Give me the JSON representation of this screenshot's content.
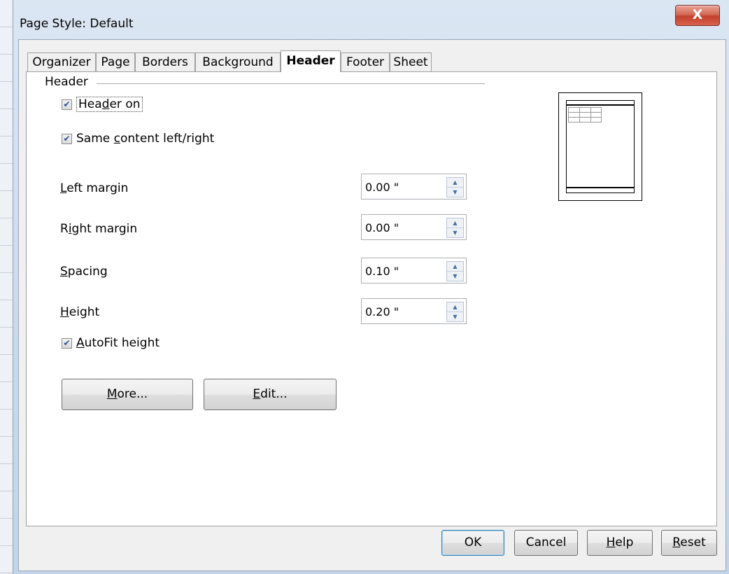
{
  "window": {
    "title": "Page Style: Default",
    "close_symbol": "X"
  },
  "tabs": [
    {
      "label": "Organizer"
    },
    {
      "label": "Page"
    },
    {
      "label": "Borders"
    },
    {
      "label": "Background"
    },
    {
      "label": "Header",
      "active": true
    },
    {
      "label": "Footer"
    },
    {
      "label": "Sheet"
    }
  ],
  "header_section": {
    "title": "Header",
    "header_on": {
      "label_pre": "Hea",
      "label_mnemonic": "d",
      "label_post": "er on",
      "checked": true
    },
    "same_content": {
      "label_pre": "Same ",
      "label_mnemonic": "c",
      "label_post": "ontent left/right",
      "checked": true
    },
    "fields": [
      {
        "label_mnemonic": "L",
        "label_rest": "eft margin",
        "value": "0.00 \""
      },
      {
        "label_pre": "R",
        "label_mnemonic": "i",
        "label_rest": "ght margin",
        "value": "0.00 \""
      },
      {
        "label_mnemonic": "S",
        "label_rest": "pacing",
        "value": "0.10 \""
      },
      {
        "label_mnemonic": "H",
        "label_rest": "eight",
        "value": "0.20 \""
      }
    ],
    "autofit": {
      "label_mnemonic": "A",
      "label_post": "utoFit height",
      "checked": true
    },
    "more_button": {
      "mnemonic": "M",
      "rest": "ore..."
    },
    "edit_button": {
      "mnemonic": "E",
      "rest": "dit..."
    }
  },
  "footer_buttons": {
    "ok": "OK",
    "cancel": "Cancel",
    "help": {
      "mnemonic": "H",
      "rest": "elp"
    },
    "reset": {
      "mnemonic": "R",
      "rest": "eset"
    }
  },
  "icons": {
    "checkbox_checked": "check-icon",
    "spin_up": "spin-up-icon",
    "spin_down": "spin-down-icon",
    "close": "close-icon"
  },
  "colors": {
    "title_bar": "#c9d9ec",
    "close_button": "#c1402c",
    "dialog_bg": "#f0f0f0",
    "panel_bg": "#ffffff",
    "default_button_border": "#3c7fb1"
  }
}
